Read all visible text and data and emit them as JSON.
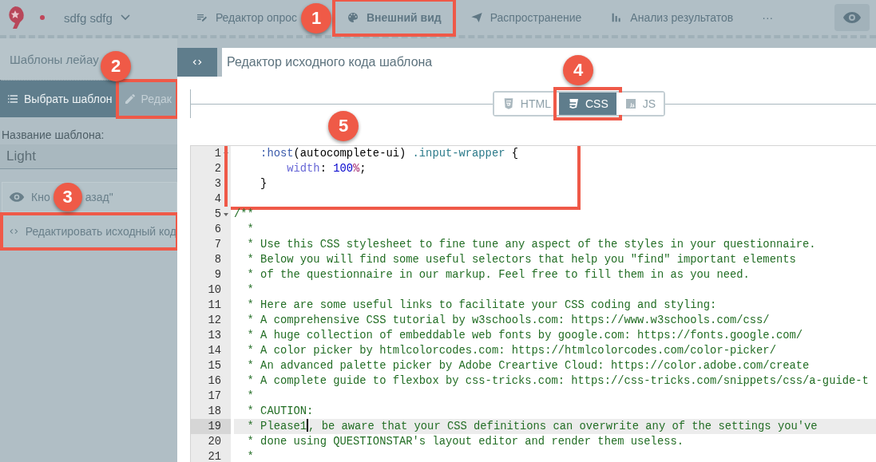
{
  "topbar": {
    "project": "sdfg sdfg",
    "nav": [
      {
        "kind": "editor",
        "label": "Редактор опрос",
        "selected": false,
        "highlighted": false
      },
      {
        "kind": "palette",
        "label": "Внешний вид",
        "selected": true,
        "highlighted": true
      },
      {
        "kind": "send",
        "label": "Распространение",
        "selected": false,
        "highlighted": false
      },
      {
        "kind": "chart",
        "label": "Анализ результатов",
        "selected": false,
        "highlighted": false
      },
      {
        "kind": "more",
        "label": "···",
        "selected": false,
        "highlighted": false
      }
    ]
  },
  "sidebar": {
    "title": "Шаблоны лейау",
    "buttons": [
      {
        "kind": "list",
        "label": "Выбрать шаблон",
        "selected": true,
        "highlighted": false
      },
      {
        "kind": "edit",
        "label": "Редак",
        "selected": false,
        "highlighted": true
      }
    ],
    "name_label": "Название шаблона:",
    "name_value": "Light",
    "items": [
      {
        "kind": "eye",
        "label_parts": [
          "Кно",
          "азад\""
        ],
        "callout": "3",
        "highlighted": false
      },
      {
        "kind": "code",
        "label_parts": [
          "Редактировать исходный код"
        ],
        "highlighted": true
      }
    ]
  },
  "editor": {
    "title": "Редактор исходного кода шаблона",
    "tabs": [
      {
        "kind": "html",
        "label": "HTML",
        "selected": false,
        "highlighted": false
      },
      {
        "kind": "css",
        "label": "CSS",
        "selected": true,
        "highlighted": true
      },
      {
        "kind": "js",
        "label": "JS",
        "selected": false,
        "highlighted": false
      }
    ],
    "blocks": [
      {
        "highlighted": true,
        "lines": [
          {
            "number": "1",
            "fold": true,
            "tokens": [
              {
                "kind": "pseudo",
                "text": "    :host"
              },
              {
                "kind": "plain",
                "text": "(autocomplete-ui) "
              },
              {
                "kind": "class",
                "text": ".input-wrapper"
              },
              {
                "kind": "plain",
                "text": " {"
              }
            ]
          },
          {
            "number": "2",
            "fold": false,
            "tokens": [
              {
                "kind": "property",
                "text": "        width"
              },
              {
                "kind": "plain",
                "text": ": "
              },
              {
                "kind": "number",
                "text": "100"
              },
              {
                "kind": "unit",
                "text": "%"
              },
              {
                "kind": "plain",
                "text": ";"
              }
            ]
          },
          {
            "number": "3",
            "fold": false,
            "tokens": [
              {
                "kind": "plain",
                "text": "    }"
              }
            ]
          },
          {
            "number": "4",
            "fold": false
          }
        ]
      },
      {
        "highlighted": false,
        "lines": [
          {
            "number": "5",
            "fold": true,
            "tokens": [
              {
                "kind": "comment",
                "text": "/**"
              }
            ]
          },
          {
            "number": "6",
            "fold": false,
            "tokens": [
              {
                "kind": "comment",
                "text": "  *"
              }
            ]
          },
          {
            "number": "7",
            "fold": false,
            "tokens": [
              {
                "kind": "comment",
                "text": "  * Use this CSS stylesheet to fine tune any aspect of the styles in your questionnaire."
              }
            ]
          },
          {
            "number": "8",
            "fold": false,
            "tokens": [
              {
                "kind": "comment",
                "text": "  * Below you will find some useful selectors that help you \"find\" important elements"
              }
            ]
          },
          {
            "number": "9",
            "fold": false,
            "tokens": [
              {
                "kind": "comment",
                "text": "  * of the questionnaire in our markup. Feel free to fill them in as you need."
              }
            ]
          },
          {
            "number": "10",
            "fold": false,
            "tokens": [
              {
                "kind": "comment",
                "text": "  *"
              }
            ]
          },
          {
            "number": "11",
            "fold": false,
            "tokens": [
              {
                "kind": "comment",
                "text": "  * Here are some useful links to facilitate your CSS coding and styling:"
              }
            ]
          },
          {
            "number": "12",
            "fold": false,
            "tokens": [
              {
                "kind": "comment",
                "text": "  * A comprehensive CSS tutorial by w3schools.com: https://www.w3schools.com/css/"
              }
            ]
          },
          {
            "number": "13",
            "fold": false,
            "tokens": [
              {
                "kind": "comment",
                "text": "  * A huge collection of embeddable web fonts by google.com: https://fonts.google.com/"
              }
            ]
          },
          {
            "number": "14",
            "fold": false,
            "tokens": [
              {
                "kind": "comment",
                "text": "  * A color picker by htmlcolorcodes.com: https://htmlcolorcodes.com/color-picker/"
              }
            ]
          },
          {
            "number": "15",
            "fold": false,
            "tokens": [
              {
                "kind": "comment",
                "text": "  * An advanced palette picker by Adobe Creartive Cloud: https://color.adobe.com/create"
              }
            ]
          },
          {
            "number": "16",
            "fold": false,
            "tokens": [
              {
                "kind": "comment",
                "text": "  * A complete guide to flexbox by css-tricks.com: https://css-tricks.com/snippets/css/a-guide-t"
              }
            ]
          },
          {
            "number": "17",
            "fold": false,
            "tokens": [
              {
                "kind": "comment",
                "text": "  *"
              }
            ]
          },
          {
            "number": "18",
            "fold": false,
            "tokens": [
              {
                "kind": "comment",
                "text": "  * CAUTION:"
              }
            ]
          },
          {
            "number": "19",
            "fold": false,
            "current": true,
            "tokens": [
              {
                "kind": "comment",
                "text": "  * Please1"
              },
              {
                "kind": "cursor"
              },
              {
                "kind": "comment",
                "text": ", be aware that your CSS definitions can overwrite any of the settings you've"
              }
            ]
          },
          {
            "number": "20",
            "fold": false,
            "tokens": [
              {
                "kind": "comment",
                "text": "  * done using QUESTIONSTAR's layout editor and render them useless."
              }
            ]
          },
          {
            "number": "21",
            "fold": false,
            "tokens": [
              {
                "kind": "comment",
                "text": "  *"
              }
            ]
          }
        ]
      }
    ]
  },
  "callouts": [
    {
      "label": "1"
    },
    {
      "label": "2"
    },
    {
      "label": "4"
    },
    {
      "label": "5"
    }
  ]
}
